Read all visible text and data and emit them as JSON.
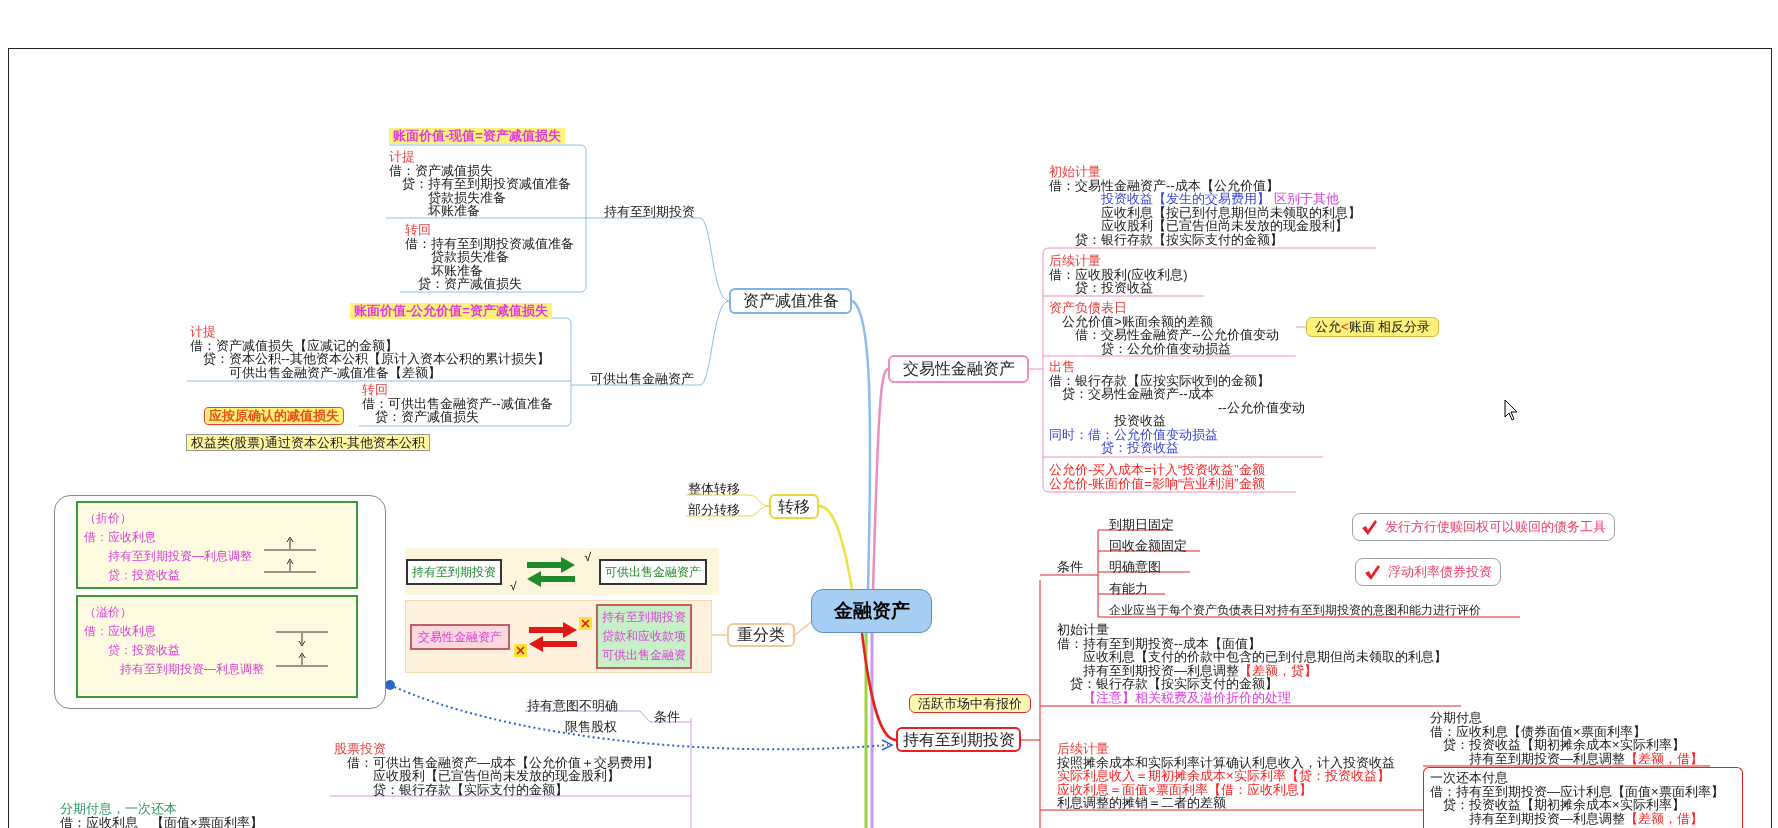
{
  "topics": [
    {
      "text": "资产减值准备",
      "kind": "main",
      "color": "#7fb2e5"
    },
    {
      "text": "交易性金融资产",
      "kind": "main",
      "color": "#f08cc0"
    },
    {
      "text": "转移",
      "kind": "main",
      "color": "#e8d83a"
    },
    {
      "text": "重分类",
      "kind": "main",
      "color": "#f4c89a"
    },
    {
      "text": "金融资产",
      "kind": "central",
      "color": "#a6cdf2"
    },
    {
      "text": "持有至到期投资",
      "kind": "main",
      "color": "#e82020"
    }
  ],
  "labels": [
    "持有至到期投资",
    "可供出售金融资产",
    "整体转移",
    "部分转移",
    "持有意图不明确",
    "限售股权",
    "条件",
    "条件",
    "到期日固定",
    "回收金额固定",
    "明确意图",
    "有能力",
    "企业应当于每个资产负债表日对持有至到期投资的意图和能力进行评价"
  ],
  "callouts": [
    {
      "kind": "highlight",
      "segments": [
        {
          "text": "账面价值-现值=资产减值损失",
          "kind": "magenta"
        }
      ]
    },
    {
      "kind": "highlight",
      "segments": [
        {
          "text": "账面价值-公允价值=资产减值损失",
          "kind": "magenta"
        }
      ]
    },
    {
      "kind": "warning",
      "segments": [
        {
          "text": "应按原确认的减值损失",
          "kind": "orange"
        }
      ]
    },
    {
      "kind": "box",
      "segments": [
        {
          "text": "权益类(股票)通过资本公积-其他资本公积",
          "kind": "plain"
        }
      ]
    },
    {
      "kind": "compare",
      "segments": [
        {
          "text": "公允",
          "kind": "plain"
        },
        {
          "text": "<",
          "kind": "red"
        },
        {
          "text": "账面 相反分录",
          "kind": "plain"
        }
      ]
    },
    {
      "kind": "speech",
      "segments": [
        {
          "text": "活跃市场中有报价",
          "kind": "plain"
        }
      ]
    },
    {
      "kind": "check",
      "segments": [
        {
          "text": "发行方行使赎回权可以赎回的债务工具",
          "kind": "pinkred"
        }
      ]
    },
    {
      "kind": "check",
      "segments": [
        {
          "text": "浮动利率债券投资",
          "kind": "pinkred"
        }
      ]
    }
  ],
  "notes": [
    {
      "lines": [
        [
          {
            "text": "计提",
            "kind": "heading"
          }
        ],
        "借：资产减值损失",
        "　贷：持有至到期投资减值准备",
        "　　　贷款损失准备",
        "　　　坏账准备"
      ]
    },
    {
      "lines": [
        [
          {
            "text": "转回",
            "kind": "heading"
          }
        ],
        "借：持有至到期投资减值准备",
        "　　贷款损失准备",
        "　　坏账准备",
        "　贷：资产减值损失"
      ]
    },
    {
      "lines": [
        [
          {
            "text": "计提",
            "kind": "heading"
          }
        ],
        "借：资产减值损失【应减记的金额】",
        "　贷：资本公积--其他资本公积【原计入资本公积的累计损失】",
        "　　　可供出售金融资产-减值准备【差额】"
      ]
    },
    {
      "lines": [
        [
          {
            "text": "转回",
            "kind": "heading"
          }
        ],
        "借：可供出售金融资产--减值准备",
        "　贷：资产减值损失"
      ]
    },
    {
      "lines": [
        [
          {
            "text": "初始计量",
            "kind": "heading"
          }
        ],
        "借：交易性金融资产--成本【公允价值】",
        [
          {
            "text": "　　　　投资收益【发生的交易费用】",
            "kind": "blue"
          },
          {
            "text": " 区别于其他",
            "kind": "magenta"
          }
        ],
        "　　　　应收利息【按已到付息期但尚未领取的利息】",
        "　　　　应收股利【已宣告但尚未发放的现金股利】",
        "　　贷：银行存款【按实际支付的金额】"
      ]
    },
    {
      "lines": [
        [
          {
            "text": "后续计量",
            "kind": "heading"
          }
        ],
        "借：应收股利(应收利息)",
        "　　贷：投资收益"
      ]
    },
    {
      "lines": [
        [
          {
            "text": "资产负债表日",
            "kind": "heading"
          }
        ],
        "　公允价值>账面余额的差额",
        "　　借：交易性金融资产--公允价值变动",
        "　　　　贷：公允价值变动损益"
      ]
    },
    {
      "lines": [
        [
          {
            "text": "出售",
            "kind": "heading"
          }
        ],
        "借：银行存款【应按实际收到的金额】",
        "　贷：交易性金融资产--成本",
        "　　　　　　　　　　　　　--公允价值变动",
        "　　　　　投资收益",
        [
          {
            "text": "同时：借：公允价值变动损益",
            "kind": "blue"
          }
        ],
        [
          {
            "text": "　　　　贷：投资收益",
            "kind": "blue"
          }
        ]
      ]
    },
    {
      "lines": [
        [
          {
            "text": "公允价-买入成本=计入“投资收益”金额",
            "kind": "red"
          }
        ],
        [
          {
            "text": "公允价-账面价值=影响“营业利润”金额",
            "kind": "red"
          }
        ]
      ]
    },
    {
      "lines": [
        "初始计量",
        "借：持有至到期投资--成本【面值】",
        "　　应收利息【支付的价款中包含的已到付息期但尚未领取的利息】",
        [
          {
            "text": "　　持有至到期投资—利息调整",
            "kind": "plain"
          },
          {
            "text": "【差额，贷】",
            "kind": "red"
          }
        ],
        "　贷：银行存款【按实际支付的金额】",
        [
          {
            "text": "　　【注意】相关税费及溢价折价的处理",
            "kind": "magenta"
          }
        ]
      ]
    },
    {
      "lines": [
        [
          {
            "text": "后续计量",
            "kind": "heading"
          }
        ],
        "按照摊余成本和实际利率计算确认利息收入，计入投资收益",
        [
          {
            "text": "实际利息收入＝期初摊余成本×实际利率【贷：投资收益】",
            "kind": "red"
          }
        ],
        [
          {
            "text": "应收利息＝面值×票面利率【借：应收利息】",
            "kind": "red"
          }
        ],
        "利息调整的摊销＝二者的差额"
      ]
    },
    {
      "lines": [
        "分期付息",
        "借：应收利息【债券面值×票面利率】",
        "　贷：投资收益【期初摊余成本×实际利率】",
        [
          {
            "text": "　　　持有至到期投资—利息调整",
            "kind": "plain"
          },
          {
            "text": "【差额，借】",
            "kind": "red"
          }
        ]
      ]
    },
    {
      "lines": [
        "一次还本付息",
        "借：持有至到期投资—应计利息【面值×票面利率】",
        "　贷：投资收益【期初摊余成本×实际利率】",
        [
          {
            "text": "　　　持有至到期投资—利息调整",
            "kind": "plain"
          },
          {
            "text": "【差额，借】",
            "kind": "red"
          }
        ]
      ]
    },
    {
      "lines": [
        [
          {
            "text": "股票投资",
            "kind": "heading"
          }
        ],
        "　借：可供出售金融资产—成本【公允价值＋交易费用】",
        "　　　应收股利【已宣告但尚未发放的现金股利】",
        "　　　贷：银行存款【实际支付的金额】"
      ]
    },
    {
      "lines": [
        [
          {
            "text": "分期付息，一次还本",
            "kind": "green"
          }
        ],
        "借：应收利息　【面值×票面利率】"
      ]
    }
  ],
  "adjustment_boxes": [
    {
      "lines": [
        "（折价）",
        "借：应收利息",
        "　　持有至到期投资—利息调整",
        "　　贷：投资收益"
      ],
      "marks": [
        {
          "kind": "up"
        },
        {
          "kind": "up"
        }
      ]
    },
    {
      "lines": [
        "（溢价）",
        "借：应收利息",
        "　　贷：投资收益",
        "　　　持有至到期投资—利息调整"
      ],
      "marks": [
        {
          "kind": "down"
        },
        {
          "kind": "up"
        }
      ]
    }
  ],
  "reclassification": [
    {
      "from": "持有至到期投资",
      "to": [
        "可供出售金融资产"
      ],
      "allowed": true,
      "marks": [
        "√",
        "√"
      ]
    },
    {
      "from": "交易性金融资产",
      "to": [
        "持有至到期投资",
        "贷款和应收款项",
        "可供出售金融资"
      ],
      "allowed": false
    }
  ]
}
